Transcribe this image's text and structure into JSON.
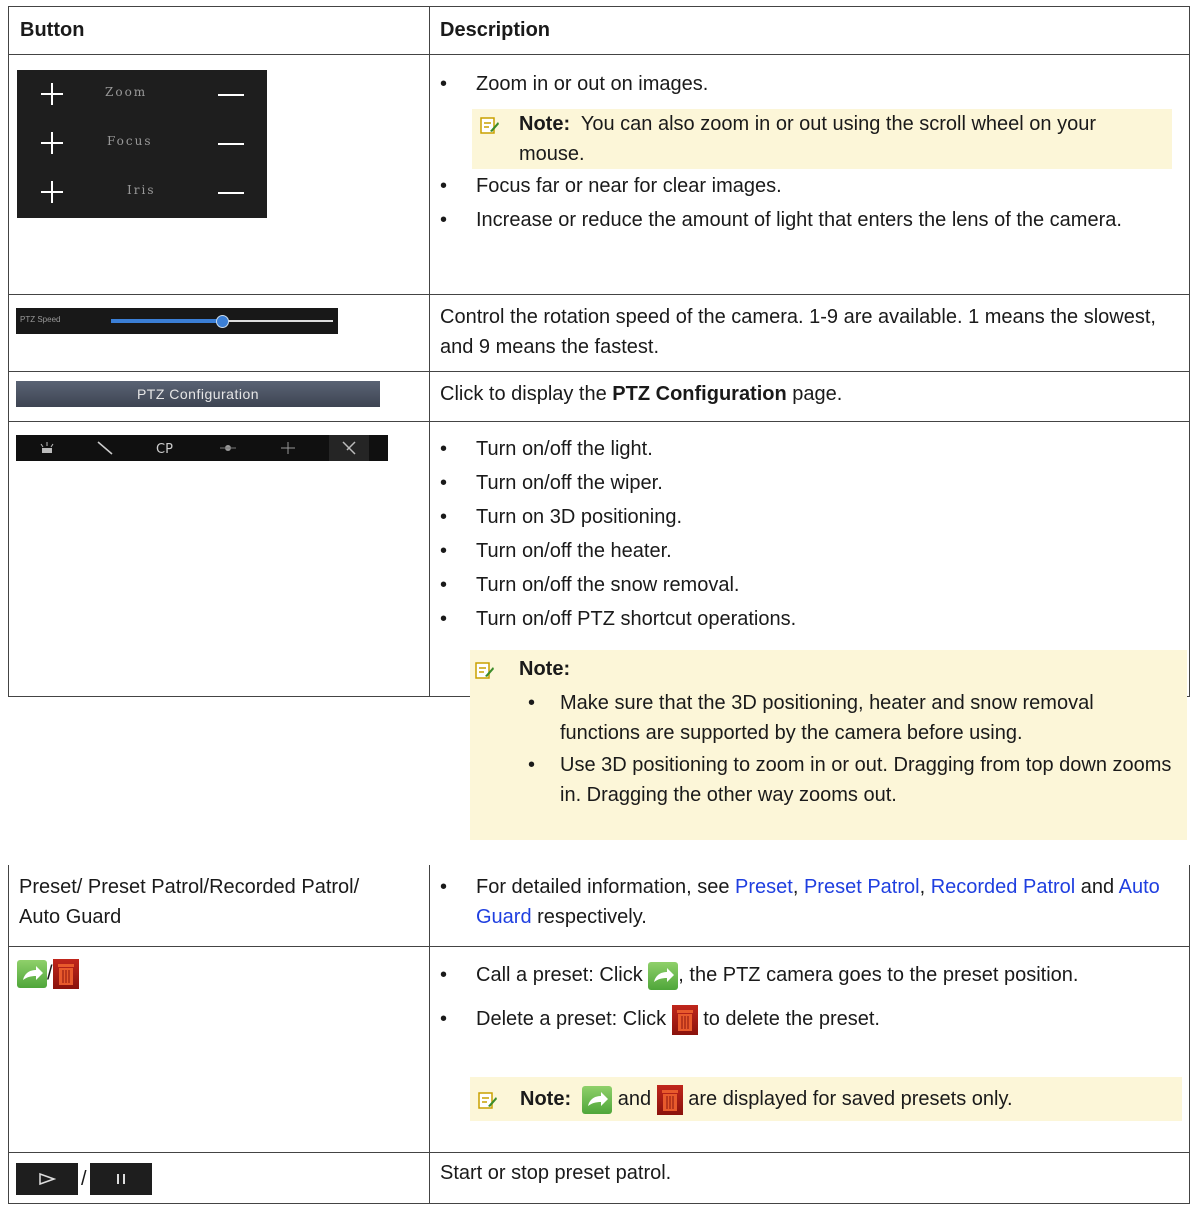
{
  "header": {
    "col1": "Button",
    "col2": "Description"
  },
  "row1": {
    "panel": {
      "zoom": "Zoom",
      "focus": "Focus",
      "iris": "Iris"
    },
    "items": [
      "Zoom in or out on images.",
      "Focus far or near for clear images.",
      "Increase or reduce the amount of light that enters the lens of the camera."
    ],
    "note_label": "Note:",
    "note_text": "You can also zoom in or out using the scroll wheel on your mouse."
  },
  "row2": {
    "slider_label": "PTZ Speed",
    "speed_fraction": 0.5,
    "desc": "Control the rotation speed of the camera. 1-9 are available. 1 means the slowest, and 9 means the fastest."
  },
  "row3": {
    "button_label": "PTZ Configuration",
    "desc_pre": "Click to display the ",
    "desc_bold": "PTZ Configuration",
    "desc_post": " page."
  },
  "row4": {
    "items": [
      "Turn on/off the light.",
      "Turn on/off the wiper.",
      "Turn on 3D positioning.",
      "Turn on/off the heater.",
      "Turn on/off the snow removal.",
      "Turn on/off PTZ shortcut operations."
    ],
    "note_label": "Note:",
    "note_items": [
      "Make sure that the 3D positioning, heater and snow removal functions are supported by the camera before using.",
      "Use 3D positioning to zoom in or out. Dragging from top down zooms in. Dragging the other way zooms out."
    ]
  },
  "row5": {
    "label": "Preset/ Preset Patrol/Recorded Patrol/ Auto Guard",
    "desc_pre": "For detailed information, see ",
    "link1": "Preset",
    "sep1": ", ",
    "link2": "Preset Patrol",
    "sep2": ", ",
    "link3": "Recorded Patrol",
    "mid": " and ",
    "link4": "Auto Guard",
    "desc_post": " respectively."
  },
  "row6": {
    "slash": "/",
    "call_pre": "Call a preset: Click ",
    "call_post": ", the PTZ camera goes to the preset position.",
    "delete_pre": "Delete a preset: Click ",
    "delete_post": " to delete the preset.",
    "note_label": "Note:",
    "note_mid": " and ",
    "note_post": " are displayed for saved presets only."
  },
  "row7": {
    "slash": "/",
    "desc": "Start or stop preset patrol."
  }
}
